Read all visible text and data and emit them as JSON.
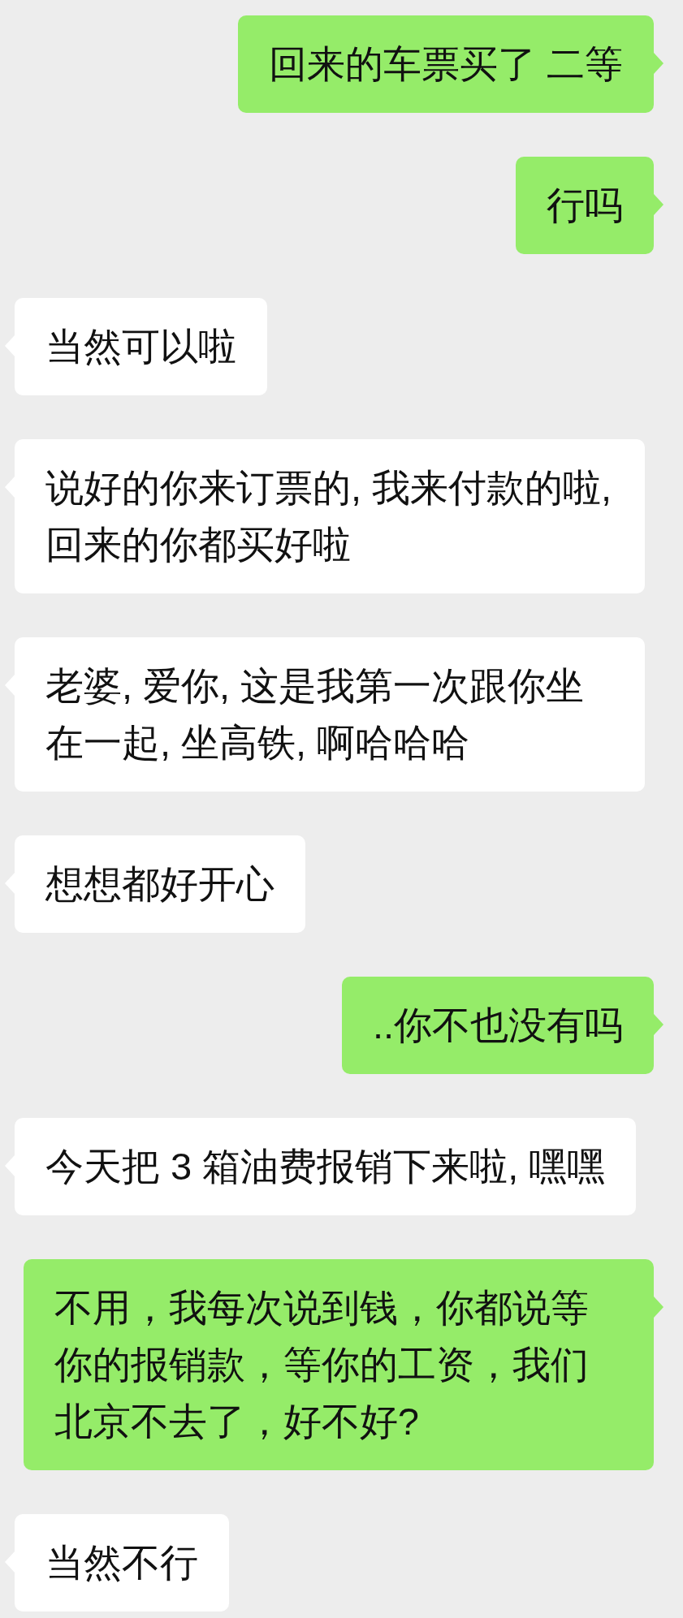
{
  "messages": [
    {
      "outgoing": true,
      "text": "回来的车票买了 二等"
    },
    {
      "outgoing": true,
      "text": "行吗"
    },
    {
      "outgoing": false,
      "text": "当然可以啦"
    },
    {
      "outgoing": false,
      "text": "说好的你来订票的, 我来付款的啦, 回来的你都买好啦"
    },
    {
      "outgoing": false,
      "text": "老婆, 爱你, 这是我第一次跟你坐在一起, 坐高铁, 啊哈哈哈"
    },
    {
      "outgoing": false,
      "text": "想想都好开心"
    },
    {
      "outgoing": true,
      "text": "..你不也没有吗"
    },
    {
      "outgoing": false,
      "text": "今天把 3 箱油费报销下来啦, 嘿嘿"
    },
    {
      "outgoing": true,
      "text": "不用，我每次说到钱，你都说等你的报销款，等你的工资，我们北京不去了，好不好?"
    },
    {
      "outgoing": false,
      "text": "当然不行"
    }
  ]
}
